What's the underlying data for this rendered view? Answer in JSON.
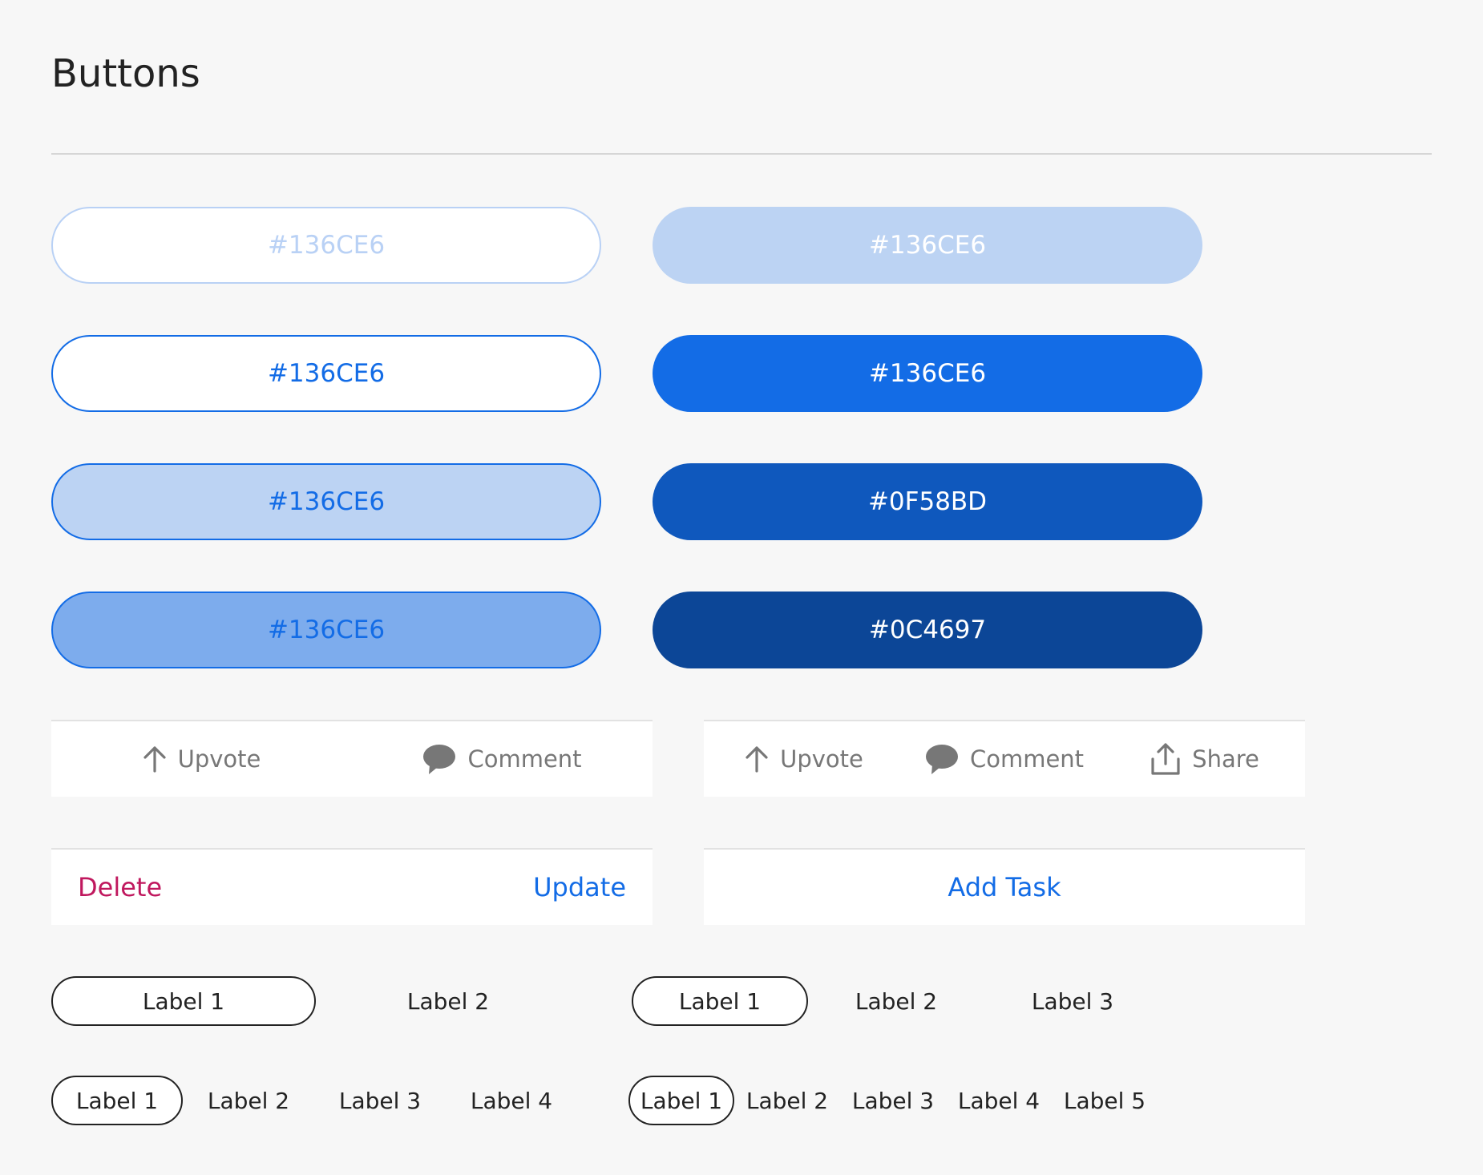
{
  "page": {
    "title": "Buttons"
  },
  "outline_buttons": [
    {
      "label": "#136CE6",
      "state": "disabled"
    },
    {
      "label": "#136CE6",
      "state": "default"
    },
    {
      "label": "#136CE6",
      "state": "hover"
    },
    {
      "label": "#136CE6",
      "state": "pressed"
    }
  ],
  "filled_buttons": [
    {
      "label": "#136CE6",
      "state": "disabled"
    },
    {
      "label": "#136CE6",
      "state": "default"
    },
    {
      "label": "#0F58BD",
      "state": "hover"
    },
    {
      "label": "#0C4697",
      "state": "pressed"
    }
  ],
  "action_bar_2": {
    "upvote": "Upvote",
    "comment": "Comment"
  },
  "action_bar_3": {
    "upvote": "Upvote",
    "comment": "Comment",
    "share": "Share"
  },
  "dialog_bar": {
    "delete": "Delete",
    "update": "Update"
  },
  "task_bar": {
    "add_task": "Add Task"
  },
  "segmented_2": [
    "Label 1",
    "Label 2"
  ],
  "segmented_3": [
    "Label 1",
    "Label 2",
    "Label 3"
  ],
  "segmented_4": [
    "Label 1",
    "Label 2",
    "Label 3",
    "Label 4"
  ],
  "segmented_5": [
    "Label 1",
    "Label 2",
    "Label 3",
    "Label 4",
    "Label 5"
  ],
  "icons": {
    "upvote": "arrow-up-icon",
    "comment": "speech-bubble-icon",
    "share": "share-icon"
  },
  "colors": {
    "primary": "#136CE6",
    "primary_hover": "#0F58BD",
    "primary_pressed": "#0C4697",
    "destructive": "#C0185E",
    "icon_gray": "#777777"
  }
}
